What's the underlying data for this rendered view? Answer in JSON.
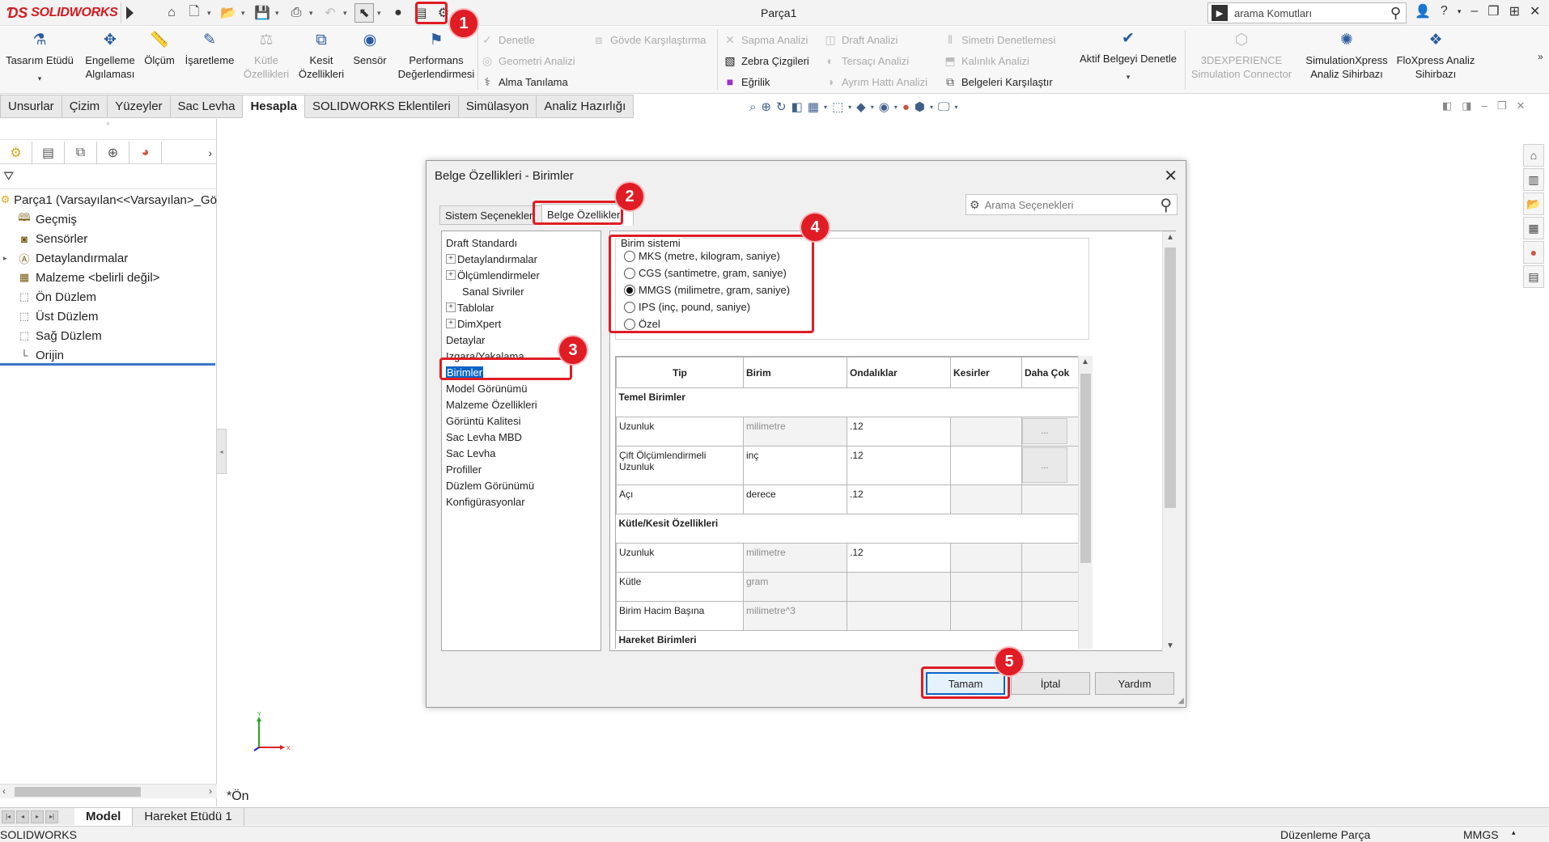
{
  "app": {
    "logo_text": "SOLIDWORKS",
    "title": "Parça1",
    "search_placeholder": "arama Komutları",
    "colors": {
      "accent": "#0a64c8",
      "brand": "#d31b20",
      "callout": "#e01c24"
    }
  },
  "ribbon": {
    "left_buttons": [
      {
        "label": "Tasarım Etüdü",
        "icon": "design-study-icon"
      },
      {
        "label": "Engelleme Algılaması",
        "icon": "interference-icon"
      },
      {
        "label": "Ölçüm",
        "icon": "measure-icon"
      },
      {
        "label": "İşaretleme",
        "icon": "markup-icon"
      },
      {
        "label": "Kütle Özellikleri",
        "icon": "mass-properties-icon"
      },
      {
        "label": "Kesit Özellikleri",
        "icon": "section-properties-icon"
      },
      {
        "label": "Sensör",
        "icon": "sensor-icon"
      },
      {
        "label": "Performans Değerlendirmesi",
        "icon": "performance-icon"
      }
    ],
    "col1": [
      "Denetle",
      "Geometri Analizi",
      "Alma Tanılama"
    ],
    "col2": [
      "Gövde Karşılaştırma"
    ],
    "col3": [
      "Sapma Analizi",
      "Zebra Çizgileri",
      "Eğrilik"
    ],
    "col4": [
      "Draft Analizi",
      "Tersaçı Analizi",
      "Ayrım Hattı Analizi"
    ],
    "col5": [
      "Simetri Denetlemesi",
      "Kalınlık Analizi",
      "Belgeleri Karşılaştır"
    ],
    "aktif_belge": "Aktif Belgeyi Denetle",
    "right_buttons": [
      {
        "label": "3DEXPERIENCE Simulation Connector",
        "icon": "3dx-icon"
      },
      {
        "label": "SimulationXpress Analiz Sihirbazı",
        "icon": "simxpress-icon"
      },
      {
        "label": "FloXpress Analiz Sihirbazı",
        "icon": "floxpress-icon"
      }
    ]
  },
  "tabs": [
    "Unsurlar",
    "Çizim",
    "Yüzeyler",
    "Sac Levha",
    "Hesapla",
    "SOLIDWORKS Eklentileri",
    "Simülasyon",
    "Analiz Hazırlığı"
  ],
  "tree": {
    "root": "Parça1  (Varsayılan<<Varsayılan>_Gö",
    "items": [
      "Geçmiş",
      "Sensörler",
      "Detaylandırmalar",
      "Malzeme <belirli değil>",
      "Ön Düzlem",
      "Üst Düzlem",
      "Sağ Düzlem",
      "Orijin"
    ]
  },
  "graphics": {
    "view_label": "*Ön",
    "axis_x": "X",
    "axis_y": "Y"
  },
  "dialog": {
    "title": "Belge Özellikleri - Birimler",
    "tab_system": "Sistem Seçenekleri",
    "tab_document": "Belge Özellikleri",
    "search_placeholder": "Arama Seçenekleri",
    "nav": [
      "Draft Standardı",
      "Detaylandırmalar",
      "Ölçümlendirmeler",
      "Sanal Sivriler",
      "Tablolar",
      "DimXpert",
      "Detaylar",
      "Izgara/Yakalama",
      "Birimler",
      "Model Görünümü",
      "Malzeme Özellikleri",
      "Görüntü Kalitesi",
      "Sac Levha MBD",
      "Sac Levha",
      "Profiller",
      "Düzlem Görünümü",
      "Konfigürasyonlar"
    ],
    "unit_system_label": "Birim sistemi",
    "unit_options": [
      "MKS (metre, kilogram, saniye)",
      "CGS (santimetre, gram, saniye)",
      "MMGS (milimetre, gram, saniye)",
      "IPS (inç, pound, saniye)",
      "Özel"
    ],
    "selected_unit": "MMGS (milimetre, gram, saniye)",
    "table": {
      "headers": [
        "Tip",
        "Birim",
        "Ondalıklar",
        "Kesirler",
        "Daha Çok"
      ],
      "sec_basic": "Temel Birimler",
      "sec_mass": "Kütle/Kesit Özellikleri",
      "sec_motion": "Hareket Birimleri",
      "basic_rows": [
        {
          "type": "Uzunluk",
          "unit": "milimetre",
          "decimals": ".12",
          "more": "..."
        },
        {
          "type": "Çift Ölçümlendirmeli Uzunluk",
          "unit": "inç",
          "decimals": ".12",
          "more": "..."
        },
        {
          "type": "Açı",
          "unit": "derece",
          "decimals": ".12",
          "more": ""
        }
      ],
      "mass_rows": [
        {
          "type": "Uzunluk",
          "unit": "milimetre",
          "decimals": ".12"
        },
        {
          "type": "Kütle",
          "unit": "gram",
          "decimals": ""
        },
        {
          "type": "Birim Hacim Başına",
          "unit": "milimetre^3",
          "decimals": ""
        }
      ]
    },
    "ok": "Tamam",
    "cancel": "İptal",
    "help": "Yardım"
  },
  "callouts": [
    "1",
    "2",
    "3",
    "4",
    "5"
  ],
  "bottom": {
    "tabs": [
      "Model",
      "Hareket Etüdü 1"
    ]
  },
  "status": {
    "left": "SOLIDWORKS",
    "mode": "Düzenleme Parça",
    "units": "MMGS"
  }
}
